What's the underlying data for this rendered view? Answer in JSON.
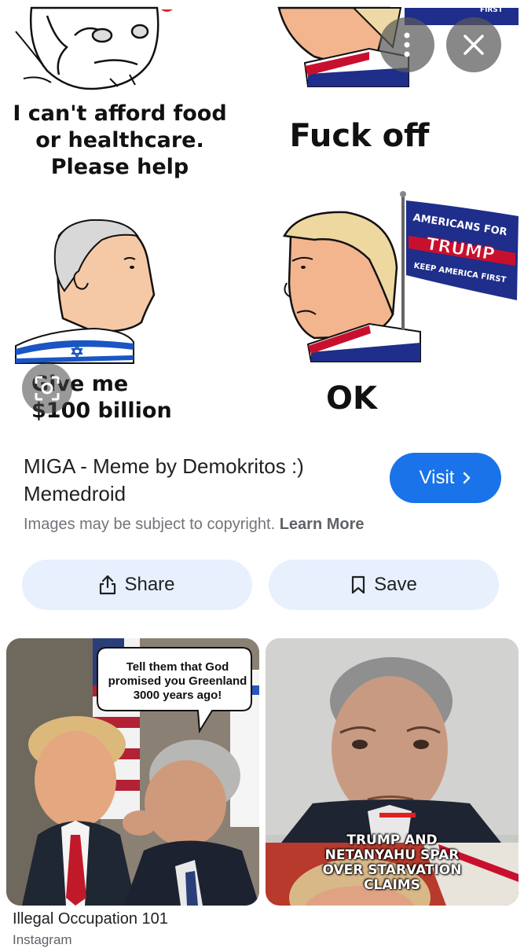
{
  "viewer": {
    "more_icon": "more-vert-icon",
    "close_icon": "close-icon",
    "lens_icon": "lens-icon"
  },
  "meme": {
    "caption_1": "I can't afford food or healthcare. Please help",
    "caption_2": "Fuck off",
    "caption_3": "Give me $100 billion",
    "caption_4": "OK",
    "flag_line_1": "AMERICANS FOR",
    "flag_line_2": "TRUMP",
    "flag_line_3": "KEEP AMERICA FIRST",
    "flag_top_fragment": "FIRST"
  },
  "result": {
    "title": "MIGA - Meme by Demokritos :) Memedroid",
    "visit_label": "Visit",
    "copyright_text": "Images may be subject to copyright.",
    "learn_more": "Learn More",
    "share_label": "Share",
    "save_label": "Save"
  },
  "related": [
    {
      "bubble_text": "Tell them that God promised you Greenland 3000 years ago!",
      "caption": "Illegal Occupation 101",
      "source": "Instagram"
    },
    {
      "headline_line_1": "TRUMP AND",
      "headline_line_2": "NETANYAHU SPAR",
      "headline_line_3": "OVER STARVATION",
      "headline_line_4": "CLAIMS"
    }
  ],
  "colors": {
    "accent": "#1a73e8",
    "pill_bg": "#e8f0fe",
    "text_primary": "#202124",
    "text_secondary": "#70757a"
  }
}
